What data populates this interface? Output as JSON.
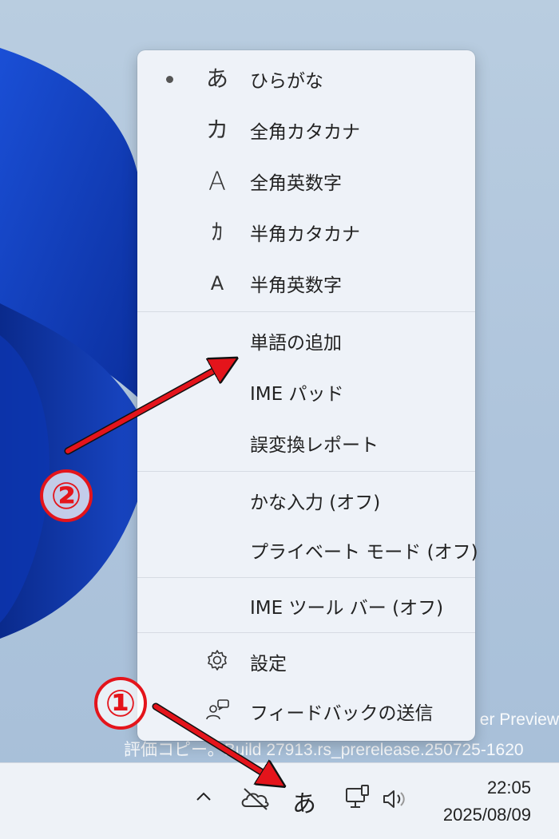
{
  "menu": {
    "input_modes": [
      {
        "glyph": "あ",
        "label": "ひらがな",
        "selected": true
      },
      {
        "glyph": "カ",
        "label": "全角カタカナ",
        "selected": false
      },
      {
        "glyph": "A",
        "label": "全角英数字",
        "selected": false
      },
      {
        "glyph": "ｶ",
        "label": "半角カタカナ",
        "selected": false
      },
      {
        "glyph": "A",
        "label": "半角英数字",
        "selected": false
      }
    ],
    "tools": [
      {
        "label": "単語の追加"
      },
      {
        "label": "IME パッド"
      },
      {
        "label": "誤変換レポート"
      }
    ],
    "modes": [
      {
        "label": "かな入力 (オフ)"
      },
      {
        "label": "プライベート モード (オフ)"
      }
    ],
    "toolbar": {
      "label": "IME ツール バー (オフ)"
    },
    "footer": [
      {
        "icon": "gear-icon",
        "label": "設定"
      },
      {
        "icon": "feedback-icon",
        "label": "フィードバックの送信"
      }
    ]
  },
  "desktop": {
    "watermark_line1": "er Preview",
    "watermark_line2": "評価コピー。Build 27913.rs_prerelease.250725-1620"
  },
  "taskbar": {
    "ime_indicator": "あ",
    "time": "22:05",
    "date": "2025/08/09"
  },
  "annotations": {
    "badge1": "①",
    "badge2": "②",
    "color": "#e4141b"
  }
}
